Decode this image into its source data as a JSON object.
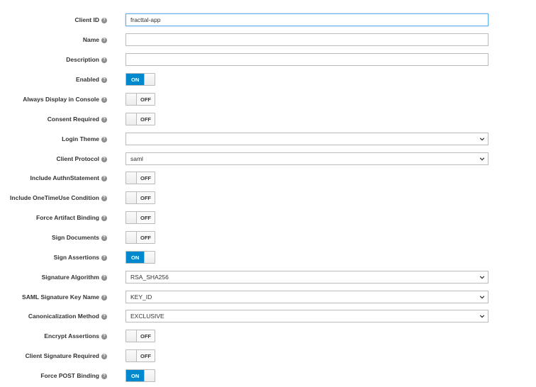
{
  "fields": {
    "client_id": {
      "label": "Client ID",
      "value": "fracttal-app"
    },
    "name": {
      "label": "Name",
      "value": ""
    },
    "description": {
      "label": "Description",
      "value": ""
    },
    "enabled": {
      "label": "Enabled",
      "state": "ON"
    },
    "always_display": {
      "label": "Always Display in Console",
      "state": "OFF"
    },
    "consent_required": {
      "label": "Consent Required",
      "state": "OFF"
    },
    "login_theme": {
      "label": "Login Theme",
      "value": ""
    },
    "client_protocol": {
      "label": "Client Protocol",
      "value": "saml"
    },
    "include_authn": {
      "label": "Include AuthnStatement",
      "state": "OFF"
    },
    "include_onetimeuse": {
      "label": "Include OneTimeUse Condition",
      "state": "OFF"
    },
    "force_artifact": {
      "label": "Force Artifact Binding",
      "state": "OFF"
    },
    "sign_documents": {
      "label": "Sign Documents",
      "state": "OFF"
    },
    "sign_assertions": {
      "label": "Sign Assertions",
      "state": "ON"
    },
    "signature_algorithm": {
      "label": "Signature Algorithm",
      "value": "RSA_SHA256"
    },
    "saml_sig_key_name": {
      "label": "SAML Signature Key Name",
      "value": "KEY_ID"
    },
    "canonicalization": {
      "label": "Canonicalization Method",
      "value": "EXCLUSIVE"
    },
    "encrypt_assertions": {
      "label": "Encrypt Assertions",
      "state": "OFF"
    },
    "client_sig_required": {
      "label": "Client Signature Required",
      "state": "OFF"
    },
    "force_post": {
      "label": "Force POST Binding",
      "state": "ON"
    }
  },
  "help_glyph": "?",
  "colors": {
    "accent": "#0088ce",
    "border": "#bbbbbb",
    "focus": "#66afe9"
  },
  "icons": {
    "help": "question-circle-icon",
    "dropdown": "chevron-down-icon"
  }
}
